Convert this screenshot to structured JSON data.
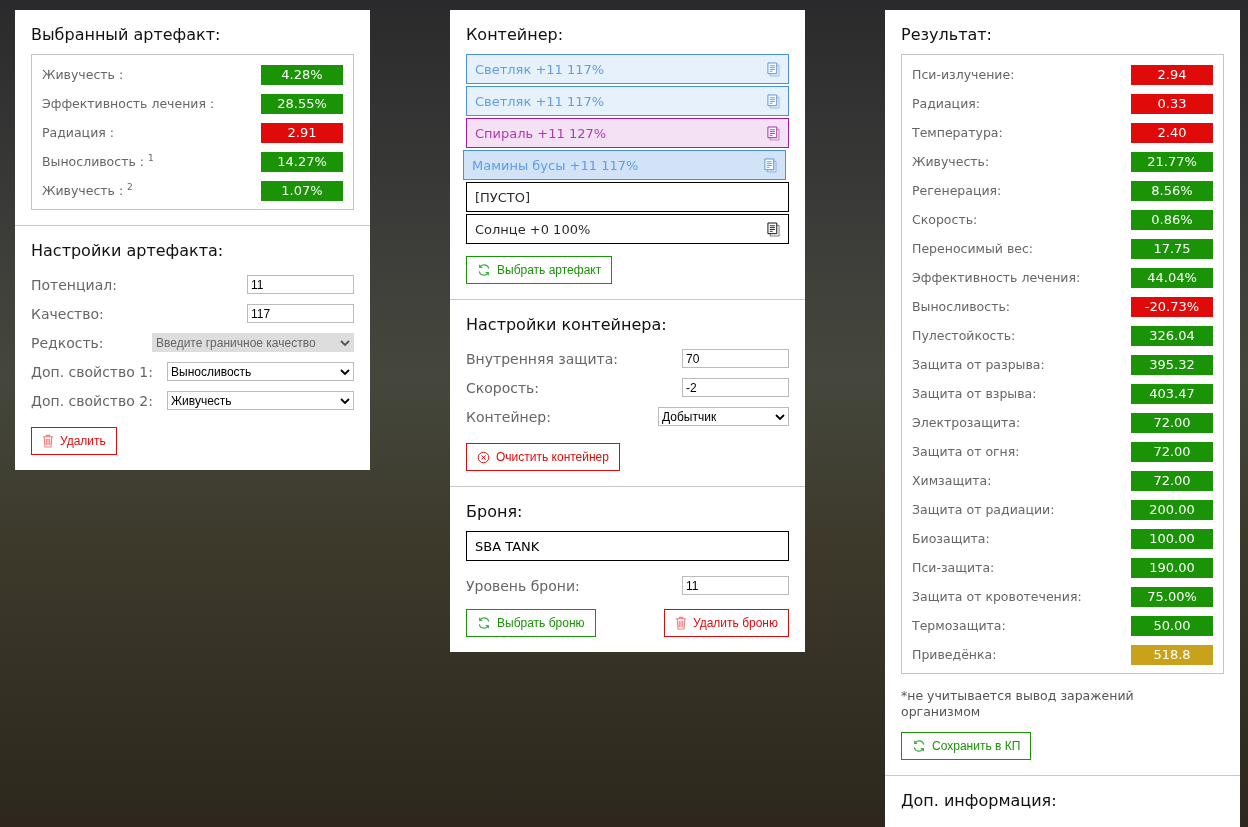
{
  "artifact_panel": {
    "title": "Выбранный артефакт:",
    "stats": [
      {
        "label": "Живучесть :",
        "value": "4.28%",
        "color": "#1a9406"
      },
      {
        "label": "Эффективность лечения :",
        "value": "28.55%",
        "color": "#1a9406"
      },
      {
        "label": "Радиация :",
        "value": "2.91",
        "color": "#e00a0a"
      },
      {
        "label": "Выносливость : $^{1}$",
        "value": "14.27%",
        "color": "#1a9406"
      },
      {
        "label": "Живучесть : $^{2}$",
        "value": "1.07%",
        "color": "#1a9406"
      }
    ],
    "settings_title": "Настройки артефакта:",
    "fields": [
      {
        "kind": "input",
        "label": "Потенциал:",
        "value": "11"
      },
      {
        "kind": "input",
        "label": "Качество:",
        "value": "117"
      },
      {
        "kind": "select",
        "label": "Редкость:",
        "value": "Введите граничное качество",
        "disabled": true
      },
      {
        "kind": "select",
        "label": "Доп. свойство 1:",
        "value": "Выносливость",
        "disabled": false
      },
      {
        "kind": "select",
        "label": "Доп. свойство 2:",
        "value": "Живучесть",
        "disabled": false
      }
    ],
    "delete_button": {
      "label": "Удалить",
      "kind": "delete"
    }
  },
  "container_panel": {
    "title": "Контейнер:",
    "slots": [
      {
        "kind": "artifact",
        "text": "Светляк +11 117%",
        "color": "#4a90e2",
        "selected": false
      },
      {
        "kind": "artifact",
        "text": "Светляк +11 117%",
        "color": "#4a90e2",
        "selected": false
      },
      {
        "kind": "artifact",
        "text": "Спираль +11 127%",
        "color": "#a81aa8",
        "selected": false
      },
      {
        "kind": "artifact",
        "text": "Мамины бусы +11 117%",
        "color": "#4a90e2",
        "selected": true
      },
      {
        "kind": "empty",
        "text": "[ПУСТО]",
        "selected": false
      },
      {
        "kind": "plain",
        "text": "Солнце +0 100%",
        "selected": false
      }
    ],
    "pick_button": {
      "label": "Выбрать артефакт",
      "kind": "select"
    },
    "settings_title": "Настройки контейнера:",
    "fields": [
      {
        "kind": "input",
        "label": "Внутренняя защита:",
        "value": "70"
      },
      {
        "kind": "input",
        "label": "Скорость:",
        "value": "-2"
      },
      {
        "kind": "select",
        "label": "Контейнер:",
        "value": "Добытчик",
        "disabled": false
      }
    ],
    "clear_button": {
      "label": "Очистить контейнер",
      "kind": "clear"
    },
    "armor_title": "Броня:",
    "armor_name": "SBA TANK",
    "armor_fields": [
      {
        "kind": "input",
        "label": "Уровень брони:",
        "value": "11"
      }
    ],
    "armor_buttons": [
      {
        "label": "Выбрать броню",
        "kind": "select"
      },
      {
        "label": "Удалить броню",
        "kind": "delete"
      }
    ]
  },
  "result_panel": {
    "title": "Результат:",
    "stats": [
      {
        "label": "Пси-излучение:",
        "value": "2.94",
        "color": "#e00a0a"
      },
      {
        "label": "Радиация:",
        "value": "0.33",
        "color": "#e00a0a"
      },
      {
        "label": "Температура:",
        "value": "2.40",
        "color": "#e00a0a"
      },
      {
        "label": "Живучесть:",
        "value": "21.77%",
        "color": "#1a9406"
      },
      {
        "label": "Регенерация:",
        "value": "8.56%",
        "color": "#1a9406"
      },
      {
        "label": "Скорость:",
        "value": "0.86%",
        "color": "#1a9406"
      },
      {
        "label": "Переносимый вес:",
        "value": "17.75",
        "color": "#1a9406"
      },
      {
        "label": "Эффективность лечения:",
        "value": "44.04%",
        "color": "#1a9406"
      },
      {
        "label": "Выносливость:",
        "value": "-20.73%",
        "color": "#e00a0a"
      },
      {
        "label": "Пулестойкость:",
        "value": "326.04",
        "color": "#1a9406"
      },
      {
        "label": "Защита от разрыва:",
        "value": "395.32",
        "color": "#1a9406"
      },
      {
        "label": "Защита от взрыва:",
        "value": "403.47",
        "color": "#1a9406"
      },
      {
        "label": "Электрозащита:",
        "value": "72.00",
        "color": "#1a9406"
      },
      {
        "label": "Защита от огня:",
        "value": "72.00",
        "color": "#1a9406"
      },
      {
        "label": "Химзащита:",
        "value": "72.00",
        "color": "#1a9406"
      },
      {
        "label": "Защита от радиации:",
        "value": "200.00",
        "color": "#1a9406"
      },
      {
        "label": "Биозащита:",
        "value": "100.00",
        "color": "#1a9406"
      },
      {
        "label": "Пси-защита:",
        "value": "190.00",
        "color": "#1a9406"
      },
      {
        "label": "Защита от кровотечения:",
        "value": "75.00%",
        "color": "#1a9406"
      },
      {
        "label": "Термозащита:",
        "value": "50.00",
        "color": "#1a9406"
      },
      {
        "label": "Приведёнка:",
        "value": "518.8",
        "color": "#c8a21a"
      }
    ],
    "note": "*не учитывается вывод заражений организмом",
    "save_button": {
      "label": "Сохранить в КП",
      "kind": "select"
    },
    "info_title": "Доп. информация:"
  }
}
